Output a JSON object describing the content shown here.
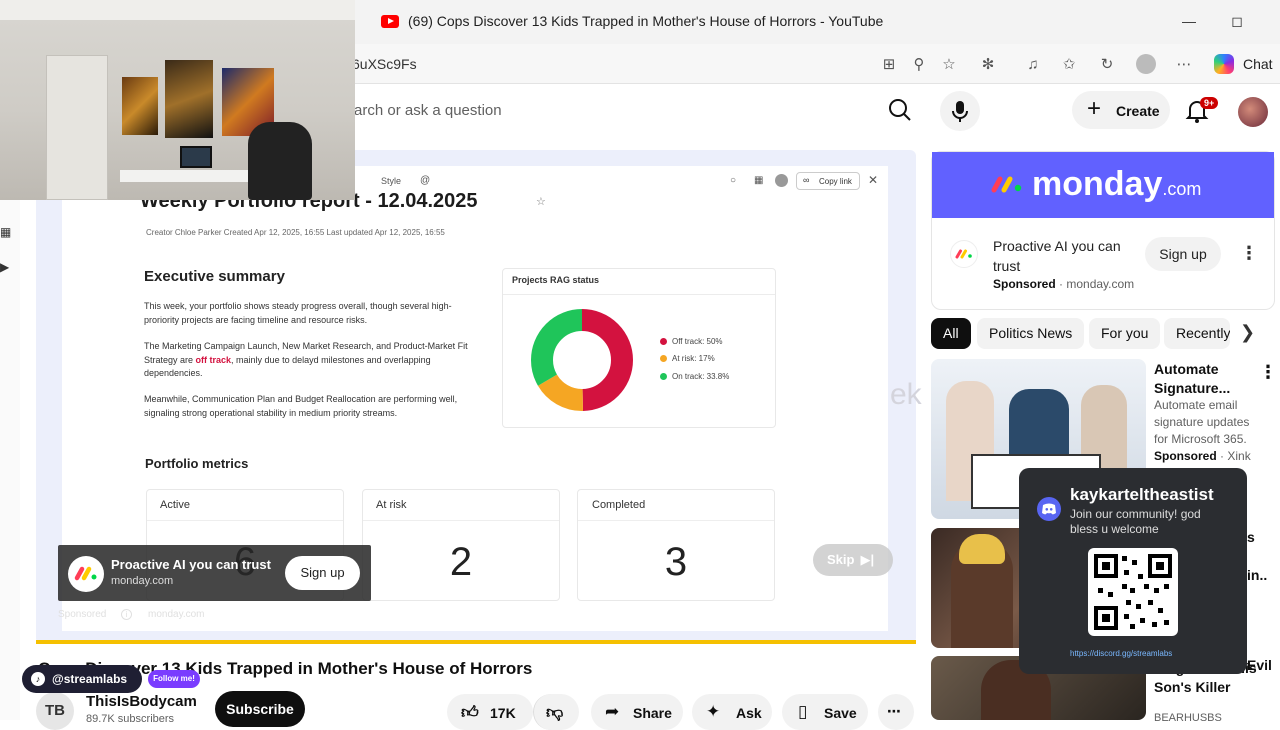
{
  "browser": {
    "tab_title": "(69) Cops Discover 13 Kids Trapped in Mother's House of Horrors - YouTube",
    "url_fragment": "6uXSc9Fs",
    "chat_label": "Chat"
  },
  "youtube_header": {
    "search_placeholder": "arch or ask a question",
    "create_label": "Create",
    "notification_count": "9+"
  },
  "video_content": {
    "style_label": "Style",
    "copy_link_label": "Copy link",
    "doc_title": "Weekly Portfolio report - 12.04.2025",
    "doc_meta": "Creator Chloe Parker    Created Apr 12, 2025, 16:55    Last updated Apr 12, 2025, 16:55",
    "exec_heading": "Executive summary",
    "exec_p1": "This week, your portfolio shows steady progress overall, though several high-proriority projects are facing timeline and resource risks.",
    "exec_p2_before": "The Marketing Campaign Launch, New Market Research, and Product-Market Fit Strategy are ",
    "exec_p2_highlight": "off track",
    "exec_p2_after": ", mainly due to delayd milestones and overlapping dependencies.",
    "exec_p3": "Meanwhile, Communication Plan and Budget Reallocation are performing well, signaling strong operational stability in medium priority streams.",
    "rag_title": "Projects RAG status",
    "rag_legend": [
      {
        "label": "Off track: 50%",
        "color": "#d3123f",
        "value": 50
      },
      {
        "label": "At risk: 17%",
        "color": "#f5a623",
        "value": 17
      },
      {
        "label": "On track: 33.8%",
        "color": "#1fc55a",
        "value": 33.8
      }
    ],
    "metrics_heading": "Portfolio metrics",
    "metrics": [
      {
        "label": "Active",
        "value": "6"
      },
      {
        "label": "At risk",
        "value": "2"
      },
      {
        "label": "Completed",
        "value": "3"
      }
    ],
    "ghost_text": "ek"
  },
  "ad_overlay": {
    "title": "Proactive AI you can trust",
    "domain": "monday.com",
    "signup_label": "Sign up",
    "sponsored_label": "Sponsored",
    "sponsored_domain": "monday.com",
    "skip_label": "Skip",
    "progress_fraction": 1.0
  },
  "video_info": {
    "title": "Cops Discover 13 Kids Trapped in Mother's House of Horrors",
    "channel_initials": "TB",
    "channel_name": "ThisIsBodycam",
    "subscribers": "89.7K subscribers",
    "subscribe_label": "Subscribe",
    "likes": "17K",
    "share_label": "Share",
    "ask_label": "Ask",
    "save_label": "Save"
  },
  "streamlabs": {
    "handle": "@streamlabs",
    "follow_label": "Follow me!"
  },
  "sidebar_ad": {
    "brand": "monday",
    "brand_suffix": ".com",
    "headline": "Proactive AI you can trust",
    "sponsored": "Sponsored",
    "domain": "monday.com",
    "signup_label": "Sign up"
  },
  "chips": [
    "All",
    "Politics News",
    "For you",
    "Recently"
  ],
  "recommended": [
    {
      "title": "Automate Signature...",
      "description": "Automate email signature updates for Microsoft 365.",
      "sponsored": "Sponsored",
      "advertiser": "Xink"
    },
    {
      "partial_1": "s",
      "partial_2": "in..",
      "partial_3": "Evil"
    },
    {
      "title": "Neighbor Is His Son's Killer",
      "subtitle": "BEARHUSBS"
    }
  ],
  "discord": {
    "name": "kaykarteltheastist",
    "message": "Join our community! god bless u welcome",
    "link": "https://discord.gg/streamlabs"
  }
}
